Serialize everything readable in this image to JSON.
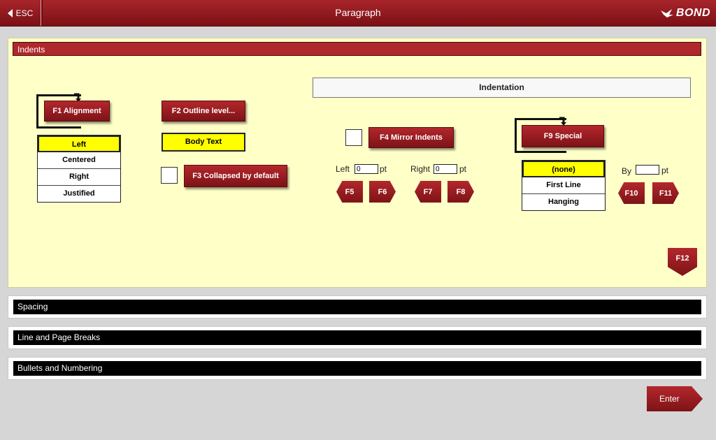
{
  "titlebar": {
    "esc_label": "ESC",
    "title": "Paragraph",
    "logo": "BOND"
  },
  "indents": {
    "section_label": "Indents",
    "alignment": {
      "button": "F1 Alignment",
      "options": [
        "Left",
        "Centered",
        "Right",
        "Justified"
      ],
      "selected": "Left"
    },
    "outline": {
      "button": "F2 Outline level...",
      "value": "Body Text"
    },
    "collapsed": {
      "button": "F3 Collapsed by default",
      "checked": false
    },
    "indentation": {
      "header": "Indentation",
      "mirror_button": "F4 Mirror Indents",
      "mirror_checked": false,
      "left_label": "Left",
      "left_value": "0",
      "left_unit": "pt",
      "right_label": "Right",
      "right_value": "0",
      "right_unit": "pt",
      "f5": "F5",
      "f6": "F6",
      "f7": "F7",
      "f8": "F8",
      "special_button": "F9 Special",
      "special_options": [
        "(none)",
        "First Line",
        "Hanging"
      ],
      "special_selected": "(none)",
      "by_label": "By",
      "by_value": "",
      "by_unit": "pt",
      "f10": "F10",
      "f11": "F11"
    },
    "f12": "F12"
  },
  "sections": [
    "Spacing",
    "Line and Page Breaks",
    "Bullets and Numbering"
  ],
  "enter_label": "Enter"
}
